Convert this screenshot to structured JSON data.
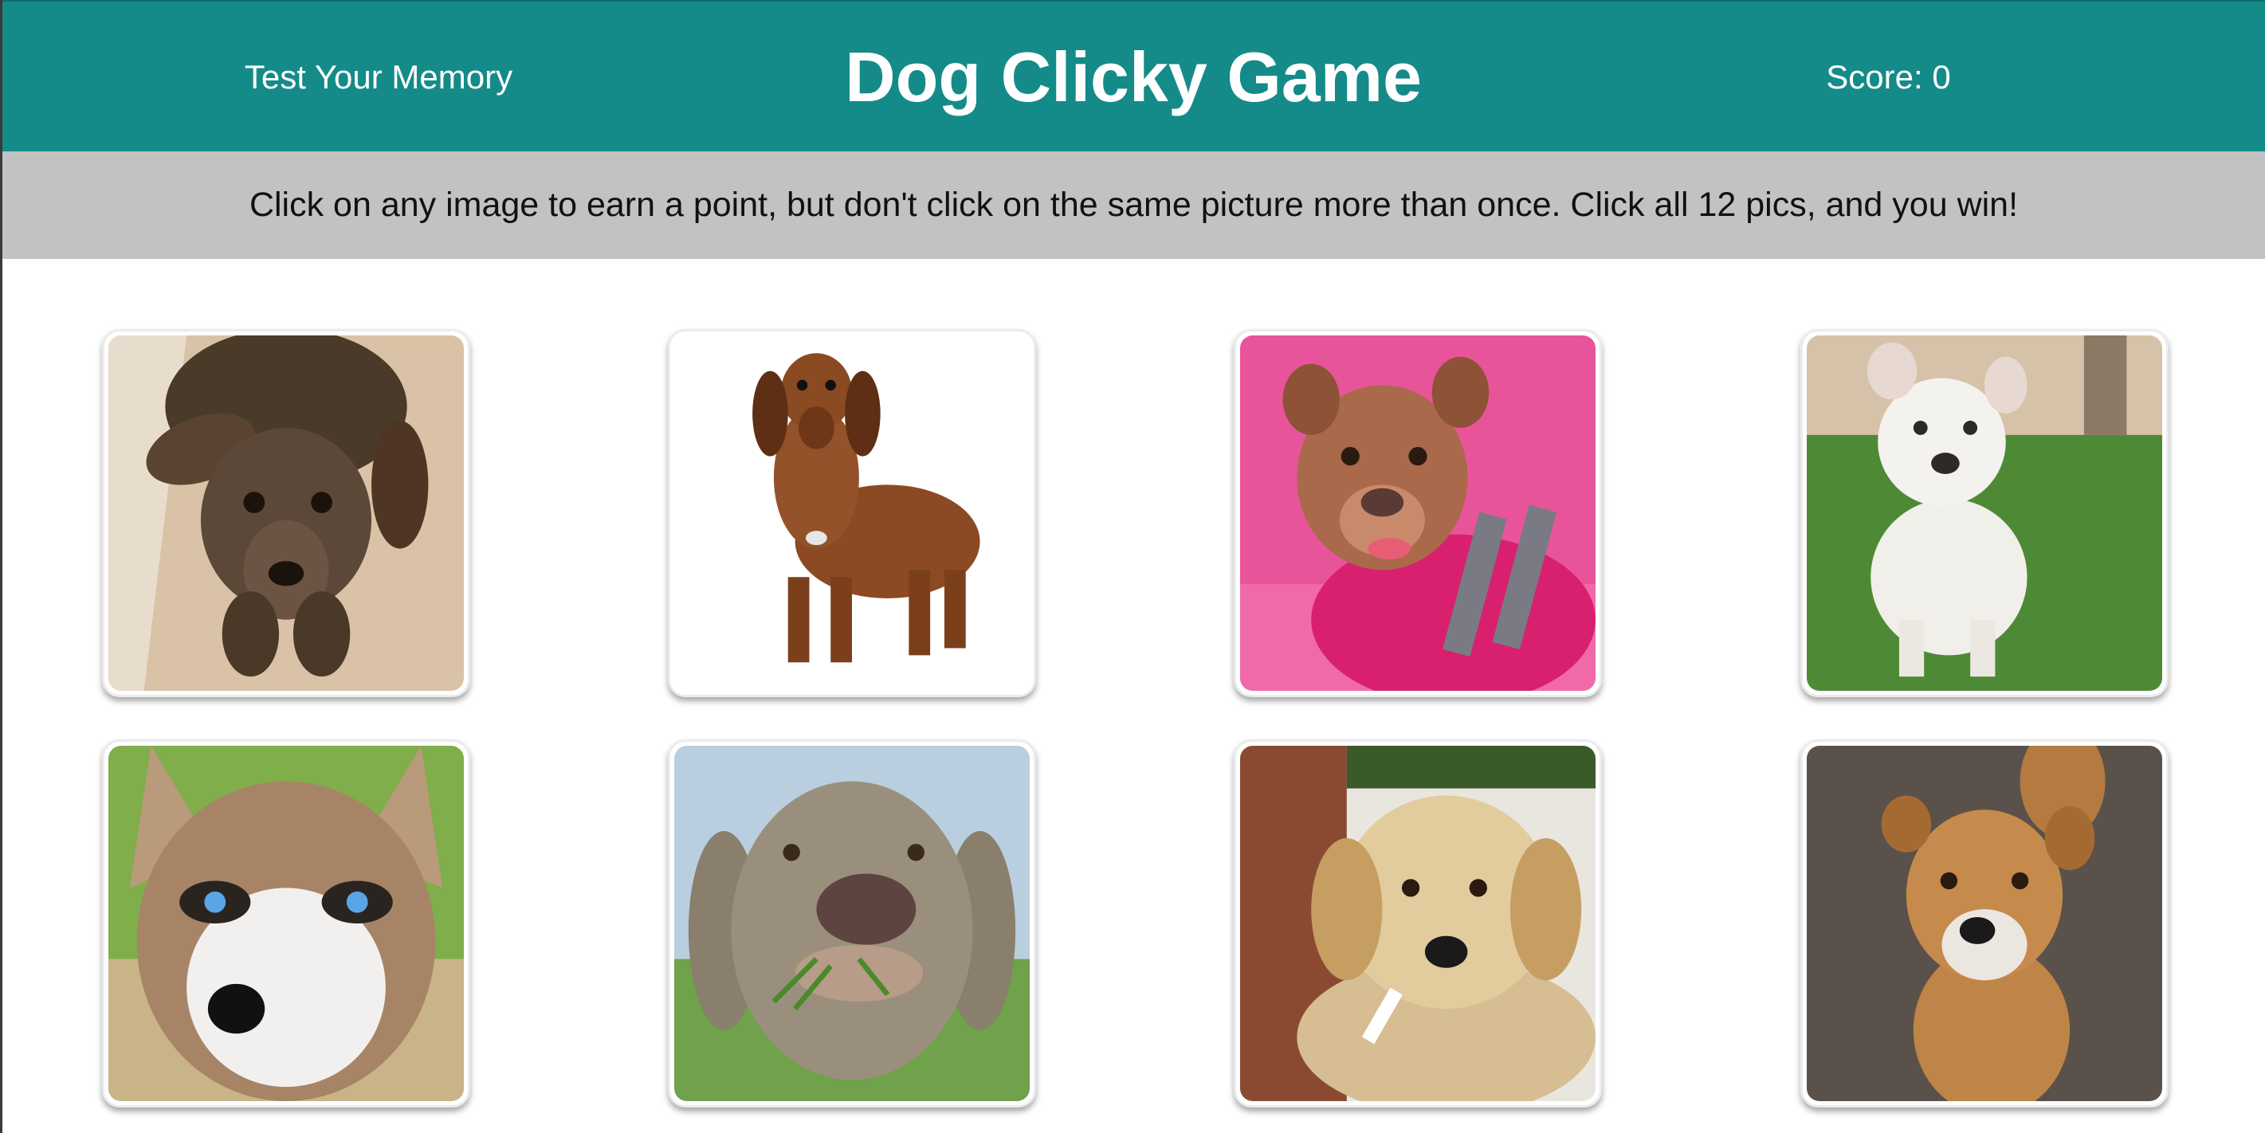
{
  "navbar": {
    "left_text": "Test Your Memory",
    "title": "Dog Clicky Game",
    "score_text": "Score: 0",
    "background_color": "#148b89"
  },
  "instructions": {
    "text": "Click on any image to earn a point, but don't click on the same picture more than once. Click all 12 pics, and you win!"
  },
  "cards": [
    {
      "subject": "dapple-dachshund-photo"
    },
    {
      "subject": "brown-dachshund-photo"
    },
    {
      "subject": "pitbull-pink-sweater-photo"
    },
    {
      "subject": "white-pitbull-grass-photo"
    },
    {
      "subject": "husky-blue-eyes-photo"
    },
    {
      "subject": "weimaraner-grass-photo"
    },
    {
      "subject": "golden-retriever-puppy-photo"
    },
    {
      "subject": "tan-mixed-dog-photo"
    }
  ]
}
